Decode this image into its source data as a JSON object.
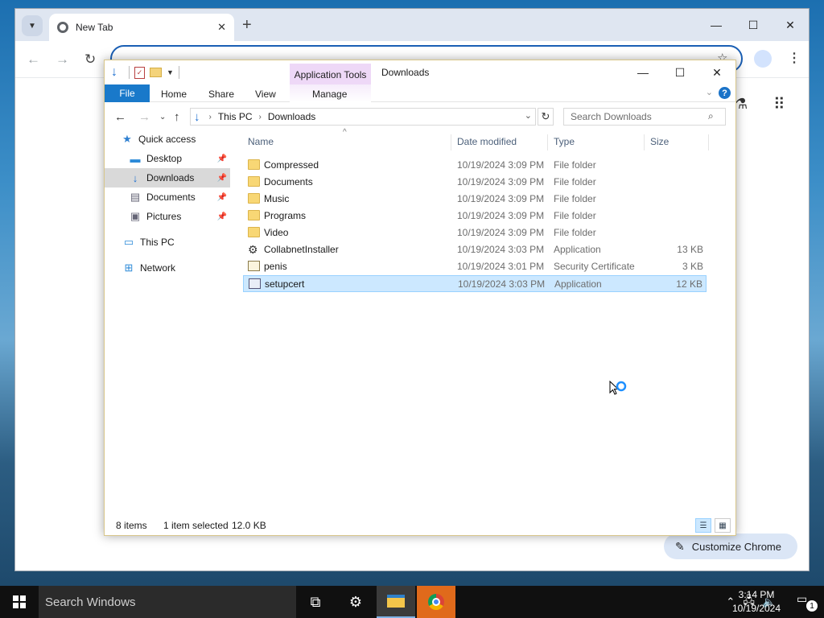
{
  "chrome": {
    "tab_title": "New Tab",
    "tab_close": "✕",
    "new_tab": "+",
    "minimize": "—",
    "maximize": "☐",
    "close": "✕",
    "back": "←",
    "forward": "→",
    "reload": "↻",
    "star": "☆",
    "customize_label": "Customize Chrome"
  },
  "explorer": {
    "window_title": "Downloads",
    "context_tab": "Application Tools",
    "ribbon_tabs": [
      "File",
      "Home",
      "Share",
      "View",
      "Manage"
    ],
    "breadcrumbs": [
      "This PC",
      "Downloads"
    ],
    "search_placeholder": "Search Downloads",
    "columns": [
      "Name",
      "Date modified",
      "Type",
      "Size"
    ],
    "nav": {
      "quick_access": "Quick access",
      "desktop": "Desktop",
      "downloads": "Downloads",
      "documents": "Documents",
      "pictures": "Pictures",
      "this_pc": "This PC",
      "network": "Network"
    },
    "files": [
      {
        "name": "Compressed",
        "date": "10/19/2024 3:09 PM",
        "type": "File folder",
        "size": "",
        "icon": "folder-icon"
      },
      {
        "name": "Documents",
        "date": "10/19/2024 3:09 PM",
        "type": "File folder",
        "size": "",
        "icon": "folder-icon"
      },
      {
        "name": "Music",
        "date": "10/19/2024 3:09 PM",
        "type": "File folder",
        "size": "",
        "icon": "folder-icon"
      },
      {
        "name": "Programs",
        "date": "10/19/2024 3:09 PM",
        "type": "File folder",
        "size": "",
        "icon": "folder-icon"
      },
      {
        "name": "Video",
        "date": "10/19/2024 3:09 PM",
        "type": "File folder",
        "size": "",
        "icon": "folder-icon"
      },
      {
        "name": "CollabnetInstaller",
        "date": "10/19/2024 3:03 PM",
        "type": "Application",
        "size": "13 KB",
        "icon": "installer-icon"
      },
      {
        "name": "penis",
        "date": "10/19/2024 3:01 PM",
        "type": "Security Certificate",
        "size": "3 KB",
        "icon": "certificate-icon"
      },
      {
        "name": "setupcert",
        "date": "10/19/2024 3:03 PM",
        "type": "Application",
        "size": "12 KB",
        "icon": "application-icon"
      }
    ],
    "status": {
      "items": "8 items",
      "selected": "1 item selected",
      "size": "12.0 KB"
    }
  },
  "taskbar": {
    "search_placeholder": "Search Windows",
    "time": "3:14 PM",
    "date": "10/19/2024",
    "notification_count": "1"
  },
  "colors": {
    "accent": "#1979ca",
    "selection": "#cce8ff",
    "context_tab": "#eed8f7",
    "chrome_taskbar_active": "#e06a1b"
  }
}
